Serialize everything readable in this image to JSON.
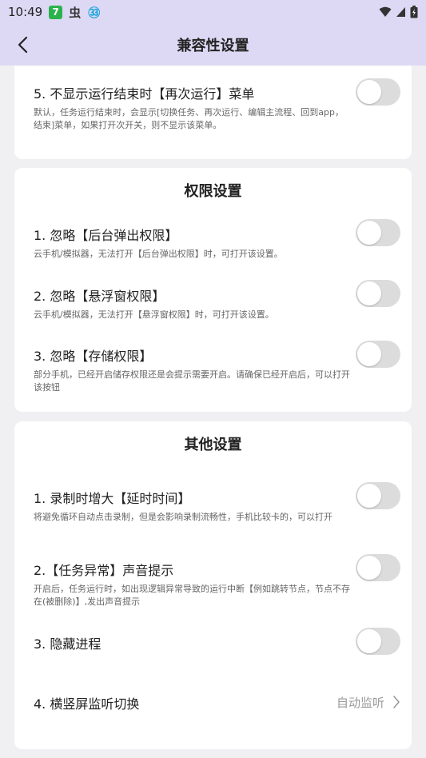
{
  "status_bar": {
    "time": "10:49",
    "app_icons": [
      "green-7-app-icon",
      "bug-icon",
      "cyan-app-icon"
    ],
    "green_app_label": "7",
    "bug_glyph": "虫",
    "cyan_glyph": "㉝"
  },
  "header": {
    "title": "兼容性设置"
  },
  "cards": {
    "top": {
      "items": [
        {
          "title": "5. 不显示运行结束时【再次运行】菜单",
          "desc": "默认，任务运行结束时，会显示[切换任务、再次运行、编辑主流程、回到app，结束]菜单，如果打开次开关，则不显示该菜单。",
          "enabled": false
        }
      ]
    },
    "permissions": {
      "title": "权限设置",
      "items": [
        {
          "title": "1. 忽略【后台弹出权限】",
          "desc": "云手机/模拟器，无法打开【后台弹出权限】时，可打开该设置。",
          "enabled": false
        },
        {
          "title": "2. 忽略【悬浮窗权限】",
          "desc": "云手机/模拟器，无法打开【悬浮窗权限】时，可打开该设置。",
          "enabled": false
        },
        {
          "title": "3. 忽略【存储权限】",
          "desc": "部分手机，已经开启储存权限还是会提示需要开启。请确保已经开启后，可以打开该按钮",
          "enabled": false
        }
      ]
    },
    "other": {
      "title": "其他设置",
      "items": [
        {
          "title": "1. 录制时增大【延时时间】",
          "desc": "将避免循环自动点击录制，但是会影响录制流畅性，手机比较卡的，可以打开",
          "enabled": false
        },
        {
          "title": "2.【任务异常】声音提示",
          "desc": "开启后，任务运行时，如出现逻辑异常导致的运行中断【例如跳转节点，节点不存在(被删除)】,发出声音提示",
          "enabled": false
        },
        {
          "title": "3. 隐藏进程",
          "enabled": false
        },
        {
          "title": "4. 横竖屏监听切换",
          "value": "自动监听"
        }
      ]
    }
  },
  "colors": {
    "header_bg": "#ddd9f4",
    "page_bg": "#f0f0f2",
    "card_bg": "#ffffff",
    "toggle_off": "#dcdcdc"
  }
}
